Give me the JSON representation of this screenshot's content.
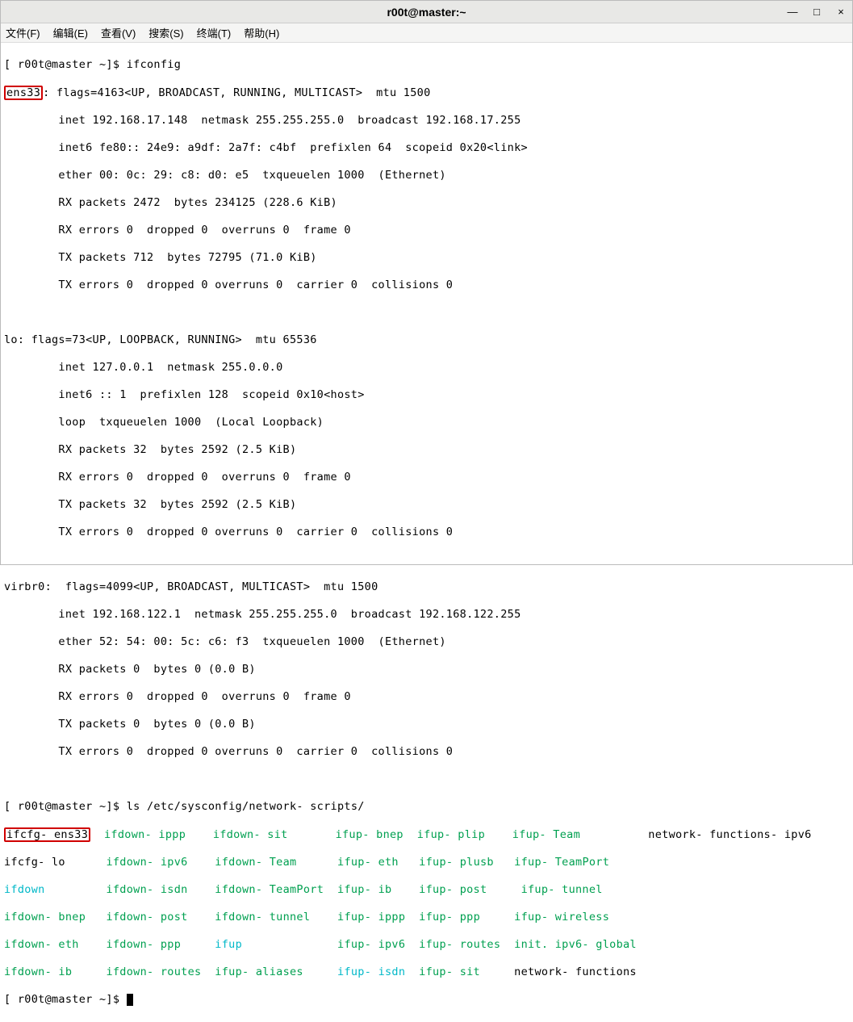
{
  "window": {
    "title": "r00t@master:~"
  },
  "window_controls": {
    "min": "—",
    "max": "□",
    "close": "×"
  },
  "menubar": {
    "file": "文件(F)",
    "edit": "编辑(E)",
    "view": "查看(V)",
    "search": "搜索(S)",
    "terminal": "终端(T)",
    "help": "帮助(H)"
  },
  "prompt1": {
    "user_host": "[ r00t@master ~]$",
    "cmd": " ifconfig"
  },
  "iface1": {
    "name": "ens33",
    "flags_label": ": flags=4163<UP, BROADCAST, RUNNING, MULTICAST>  mtu 1500",
    "inet": "        inet 192.168.17.148  netmask 255.255.255.0  broadcast 192.168.17.255",
    "inet6": "        inet6 fe80:: 24e9: a9df: 2a7f: c4bf  prefixlen 64  scopeid 0x20<link>",
    "ether": "        ether 00: 0c: 29: c8: d0: e5  txqueuelen 1000  (Ethernet)",
    "rxp": "        RX packets 2472  bytes 234125 (228.6 KiB)",
    "rxe": "        RX errors 0  dropped 0  overruns 0  frame 0",
    "txp": "        TX packets 712  bytes 72795 (71.0 KiB)",
    "txe": "        TX errors 0  dropped 0 overruns 0  carrier 0  collisions 0"
  },
  "iface2": {
    "head": "lo: flags=73<UP, LOOPBACK, RUNNING>  mtu 65536",
    "inet": "        inet 127.0.0.1  netmask 255.0.0.0",
    "inet6": "        inet6 :: 1  prefixlen 128  scopeid 0x10<host>",
    "loop": "        loop  txqueuelen 1000  (Local Loopback)",
    "rxp": "        RX packets 32  bytes 2592 (2.5 KiB)",
    "rxe": "        RX errors 0  dropped 0  overruns 0  frame 0",
    "txp": "        TX packets 32  bytes 2592 (2.5 KiB)",
    "txe": "        TX errors 0  dropped 0 overruns 0  carrier 0  collisions 0"
  },
  "iface3": {
    "head": "virbr0:  flags=4099<UP, BROADCAST, MULTICAST>  mtu 1500",
    "inet": "        inet 192.168.122.1  netmask 255.255.255.0  broadcast 192.168.122.255",
    "ether": "        ether 52: 54: 00: 5c: c6: f3  txqueuelen 1000  (Ethernet)",
    "rxp": "        RX packets 0  bytes 0 (0.0 B)",
    "rxe": "        RX errors 0  dropped 0  overruns 0  frame 0",
    "txp": "        TX packets 0  bytes 0 (0.0 B)",
    "txe": "        TX errors 0  dropped 0 overruns 0  carrier 0  collisions 0"
  },
  "prompt2": {
    "user_host": "[ r00t@master ~]$",
    "cmd": " ls /etc/sysconfig/network- scripts/"
  },
  "ls": {
    "r0": {
      "c0": "ifcfg- ens33",
      "c1": "ifdown- ippp",
      "c2": "ifdown- sit",
      "c3": "ifup- bnep",
      "c4": "ifup- plip",
      "c5": "ifup- Team",
      "c6": "network- functions- ipv6"
    },
    "r1": {
      "c0": "ifcfg- lo   ",
      "c1": "ifdown- ipv6",
      "c2": "ifdown- Team",
      "c3": "ifup- eth ",
      "c4": "ifup- plusb",
      "c5": "ifup- TeamPort"
    },
    "r2": {
      "c0": "ifdown",
      "c1": "ifdown- isdn",
      "c2": "ifdown- TeamPort",
      "c3": "ifup- ib  ",
      "c4": "ifup- post ",
      "c5": "ifup- tunnel"
    },
    "r3": {
      "c0": "ifdown- bnep",
      "c1": "ifdown- post",
      "c2": "ifdown- tunnel",
      "c3": "ifup- ippp",
      "c4": "ifup- ppp  ",
      "c5": "ifup- wireless"
    },
    "r4": {
      "c0": "ifdown- eth ",
      "c1": "ifdown- ppp",
      "c2": "ifup",
      "c3": "ifup- ipv6",
      "c4": "ifup- routes",
      "c5": "init. ipv6- global"
    },
    "r5": {
      "c0": "ifdown- ib  ",
      "c1": "ifdown- routes",
      "c2": "ifup- aliases",
      "c3": "ifup- isdn",
      "c4": "ifup- sit  ",
      "c5": "network- functions"
    }
  },
  "prompt3": {
    "user_host": "[ r00t@master ~]$"
  }
}
